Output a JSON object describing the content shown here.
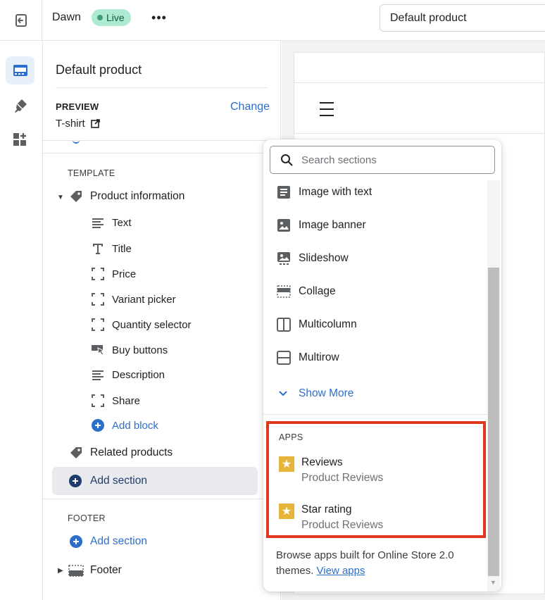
{
  "topbar": {
    "theme_name": "Dawn",
    "status_badge": "Live",
    "more_label": "•••",
    "template_select": "Default product"
  },
  "sidebar": {
    "title": "Default product",
    "preview": {
      "label": "PREVIEW",
      "change": "Change",
      "value": "T-shirt"
    },
    "template": {
      "label": "TEMPLATE",
      "section_title": "Product information",
      "blocks": [
        {
          "label": "Text",
          "icon": "text-lines-icon"
        },
        {
          "label": "Title",
          "icon": "title-t-icon"
        },
        {
          "label": "Price",
          "icon": "dashed-box-icon"
        },
        {
          "label": "Variant picker",
          "icon": "dashed-box-icon"
        },
        {
          "label": "Quantity selector",
          "icon": "dashed-box-icon"
        },
        {
          "label": "Buy buttons",
          "icon": "buy-button-icon"
        },
        {
          "label": "Description",
          "icon": "text-lines-icon"
        },
        {
          "label": "Share",
          "icon": "dashed-box-icon"
        }
      ],
      "add_block": "Add block",
      "related_products": "Related products",
      "add_section": "Add section"
    },
    "footer": {
      "label": "FOOTER",
      "add_section": "Add section",
      "footer_item": "Footer"
    }
  },
  "popover": {
    "search_placeholder": "Search sections",
    "sections": [
      {
        "label": "Image with text",
        "icon": "image-with-text-icon"
      },
      {
        "label": "Image banner",
        "icon": "image-banner-icon"
      },
      {
        "label": "Slideshow",
        "icon": "slideshow-icon"
      },
      {
        "label": "Collage",
        "icon": "collage-icon"
      },
      {
        "label": "Multicolumn",
        "icon": "multicolumn-icon"
      },
      {
        "label": "Multirow",
        "icon": "multirow-icon"
      }
    ],
    "show_more": "Show More",
    "apps": {
      "label": "APPS",
      "items": [
        {
          "name": "Reviews",
          "provider": "Product Reviews"
        },
        {
          "name": "Star rating",
          "provider": "Product Reviews"
        }
      ]
    },
    "browse_text": "Browse apps built for Online Store 2.0 themes.",
    "view_apps": "View apps"
  },
  "colors": {
    "accent": "#2c6ecb",
    "highlight_border": "#e0371f",
    "app_star": "#e7b53b",
    "live_badge": "#aee9d1"
  }
}
